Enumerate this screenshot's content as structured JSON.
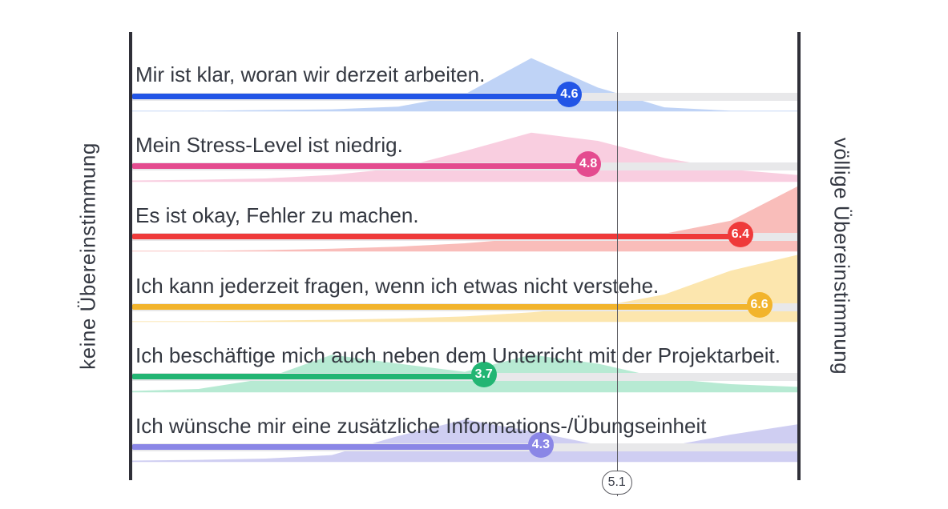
{
  "axis": {
    "left_label": "keine Übereinstimmung",
    "right_label": "völlige Übereinstimmung"
  },
  "scale": {
    "min": 0,
    "max": 7
  },
  "average": {
    "value": 5.1
  },
  "rows": [
    {
      "label": "Mir ist klar, woran wir derzeit arbeiten.",
      "value": 4.6,
      "color_bar": "#2255e6",
      "color_fill": "#b4cbf4",
      "curve": [
        0.01,
        0.01,
        0.02,
        0.03,
        0.07,
        0.25,
        0.78,
        0.35,
        0.06,
        0.01,
        0.01
      ]
    },
    {
      "label": "Mein Stress-Level ist niedrig.",
      "value": 4.8,
      "color_bar": "#e44b8f",
      "color_fill": "#f8c6da",
      "curve": [
        0.02,
        0.03,
        0.05,
        0.1,
        0.2,
        0.45,
        0.72,
        0.6,
        0.35,
        0.18,
        0.1
      ]
    },
    {
      "label": "Es ist okay, Fehler zu machen.",
      "value": 6.4,
      "color_bar": "#ef3a3a",
      "color_fill": "#f8b2ae",
      "curve": [
        0.01,
        0.01,
        0.02,
        0.04,
        0.07,
        0.12,
        0.2,
        0.22,
        0.26,
        0.45,
        0.95
      ]
    },
    {
      "label": "Ich kann jederzeit fragen, wenn ich etwas nicht verstehe.",
      "value": 6.6,
      "color_bar": "#f2b42c",
      "color_fill": "#fbe2a0",
      "curve": [
        0.01,
        0.01,
        0.02,
        0.03,
        0.05,
        0.08,
        0.14,
        0.22,
        0.4,
        0.75,
        0.98
      ]
    },
    {
      "label": "Ich beschäftige mich auch neben dem Unterricht mit der Projektarbeit.",
      "value": 3.7,
      "color_bar": "#22b573",
      "color_fill": "#aae6cb",
      "curve": [
        0.02,
        0.05,
        0.2,
        0.55,
        0.42,
        0.3,
        0.55,
        0.42,
        0.2,
        0.12,
        0.08
      ]
    },
    {
      "label": "Ich wünsche mir eine zusätzliche Informations-/Übungseinheit",
      "value": 4.3,
      "color_bar": "#8a86e6",
      "color_fill": "#c7c5f0",
      "curve": [
        0.02,
        0.03,
        0.05,
        0.1,
        0.38,
        0.62,
        0.45,
        0.25,
        0.22,
        0.4,
        0.55
      ]
    }
  ],
  "chart_data": {
    "type": "bar",
    "title": "",
    "xlabel": "",
    "ylabel": "",
    "x_axis_left": "keine Übereinstimmung",
    "x_axis_right": "völlige Übereinstimmung",
    "xlim": [
      0,
      7
    ],
    "average": 5.1,
    "categories": [
      "Mir ist klar, woran wir derzeit arbeiten.",
      "Mein Stress-Level ist niedrig.",
      "Es ist okay, Fehler zu machen.",
      "Ich kann jederzeit fragen, wenn ich etwas nicht verstehe.",
      "Ich beschäftige mich auch neben dem Unterricht mit der Projektarbeit.",
      "Ich wünsche mir eine zusätzliche Informations-/Übungseinheit"
    ],
    "values": [
      4.6,
      4.8,
      6.4,
      6.6,
      3.7,
      4.3
    ]
  }
}
